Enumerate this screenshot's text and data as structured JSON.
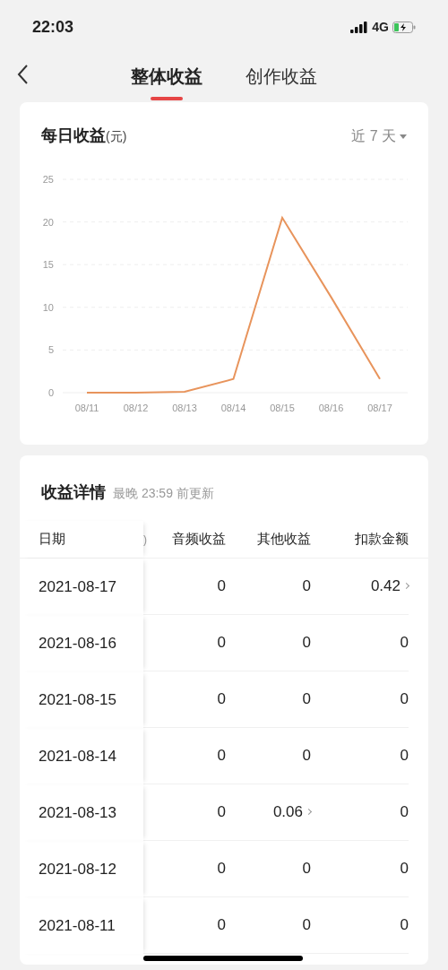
{
  "status_bar": {
    "time": "22:03",
    "network": "4G"
  },
  "nav": {
    "tabs": [
      {
        "label": "整体收益",
        "selected": true
      },
      {
        "label": "创作收益",
        "selected": false
      }
    ]
  },
  "daily_card": {
    "title": "每日收益",
    "unit": "(元)",
    "range": "近 7 天",
    "chart_data": {
      "type": "line",
      "grid": true,
      "categories": [
        "08/11",
        "08/12",
        "08/13",
        "08/14",
        "08/15",
        "08/16",
        "08/17"
      ],
      "ylim": [
        0,
        25
      ],
      "yticks": [
        0,
        5,
        10,
        15,
        20,
        25
      ],
      "series": [
        {
          "color": "#e8945c",
          "values": [
            0,
            0,
            0.1,
            1.6,
            20.5,
            11.2,
            1.6
          ]
        }
      ]
    }
  },
  "detail_card": {
    "title": "收益详情",
    "note": "最晚 23:59 前更新",
    "columns": [
      "日期",
      ")",
      "音频收益",
      "其他收益",
      "扣款金额"
    ],
    "rows": [
      {
        "cells": [
          {
            "text": "2021-08-17"
          },
          {
            "text": ""
          },
          {
            "text": "0",
            "detail": false
          },
          {
            "text": "0",
            "detail": false
          },
          {
            "text": "0.42",
            "detail": true
          }
        ]
      },
      {
        "cells": [
          {
            "text": "2021-08-16"
          },
          {
            "text": ""
          },
          {
            "text": "0",
            "detail": false
          },
          {
            "text": "0",
            "detail": false
          },
          {
            "text": "0",
            "detail": false
          }
        ]
      },
      {
        "cells": [
          {
            "text": "2021-08-15"
          },
          {
            "text": ""
          },
          {
            "text": "0",
            "detail": false
          },
          {
            "text": "0",
            "detail": false
          },
          {
            "text": "0",
            "detail": false
          }
        ]
      },
      {
        "cells": [
          {
            "text": "2021-08-14"
          },
          {
            "text": ""
          },
          {
            "text": "0",
            "detail": false
          },
          {
            "text": "0",
            "detail": false
          },
          {
            "text": "0",
            "detail": false
          }
        ]
      },
      {
        "cells": [
          {
            "text": "2021-08-13"
          },
          {
            "text": ""
          },
          {
            "text": "0",
            "detail": false
          },
          {
            "text": "0.06",
            "detail": true
          },
          {
            "text": "0",
            "detail": false
          }
        ]
      },
      {
        "cells": [
          {
            "text": "2021-08-12"
          },
          {
            "text": ""
          },
          {
            "text": "0",
            "detail": false
          },
          {
            "text": "0",
            "detail": false
          },
          {
            "text": "0",
            "detail": false
          }
        ]
      },
      {
        "cells": [
          {
            "text": "2021-08-11"
          },
          {
            "text": ""
          },
          {
            "text": "0",
            "detail": false
          },
          {
            "text": "0",
            "detail": false
          },
          {
            "text": "0",
            "detail": false
          }
        ]
      }
    ]
  }
}
